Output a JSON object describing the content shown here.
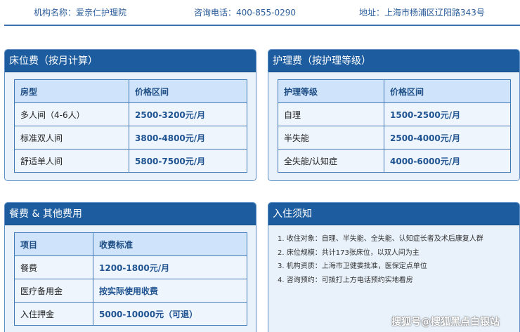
{
  "header": {
    "name_label": "机构名称：爱亲仁护理院",
    "phone_label": "咨询电话：400-855-0290",
    "address_label": "地址：上海市杨浦区辽阳路343号"
  },
  "bed_fee": {
    "title": "床位费（按月计算）",
    "columns": [
      "房型",
      "价格区间"
    ],
    "rows": [
      {
        "type": "多人间（4-6人）",
        "price": "2500-3200元/月"
      },
      {
        "type": "标准双人间",
        "price": "3800-4800元/月"
      },
      {
        "type": "舒适单人间",
        "price": "5800-7500元/月"
      }
    ]
  },
  "care_fee": {
    "title": "护理费（按护理等级）",
    "columns": [
      "护理等级",
      "价格区间"
    ],
    "rows": [
      {
        "level": "自理",
        "price": "1500-2500元/月"
      },
      {
        "level": "半失能",
        "price": "2500-4000元/月"
      },
      {
        "level": "全失能/认知症",
        "price": "4000-6000元/月"
      }
    ]
  },
  "meal_fee": {
    "title": "餐费 & 其他费用",
    "columns": [
      "项目",
      "收费标准"
    ],
    "rows": [
      {
        "item": "餐费",
        "price": "1200-1800元/月"
      },
      {
        "item": "医疗备用金",
        "price": "按实际使用收费"
      },
      {
        "item": "入住押金",
        "price": "5000-10000元（可退）"
      }
    ]
  },
  "notice": {
    "title": "入住须知",
    "items": [
      "1. 收住对象：自理、半失能、全失能、认知症长者及术后康复人群",
      "2. 床位规模：共计173张床位，以双人间为主",
      "3. 机构资质：上海市卫健委批准，医保定点单位",
      "4. 咨询预约：可拨打上方电话预约实地看房"
    ]
  },
  "watermark": "搜狐号@搜狐黑点白银站"
}
